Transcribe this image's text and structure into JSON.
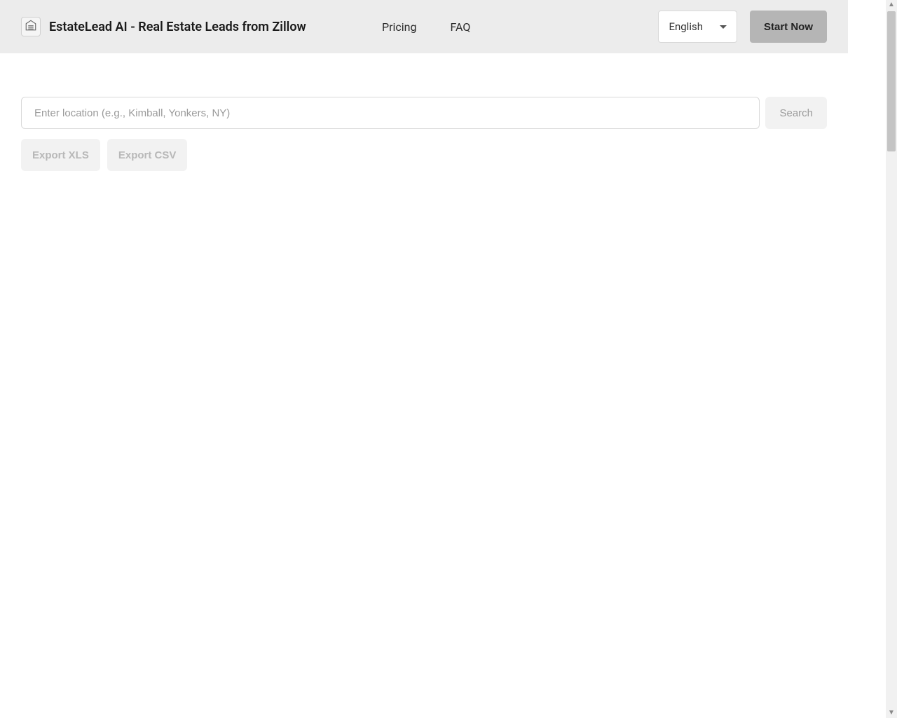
{
  "header": {
    "title": "EstateLead AI - Real Estate Leads from Zillow",
    "nav": {
      "pricing": "Pricing",
      "faq": "FAQ"
    },
    "language": {
      "selected": "English"
    },
    "start_button": "Start Now"
  },
  "search": {
    "placeholder": "Enter location (e.g., Kimball, Yonkers, NY)",
    "button": "Search"
  },
  "export": {
    "xls": "Export XLS",
    "csv": "Export CSV"
  }
}
